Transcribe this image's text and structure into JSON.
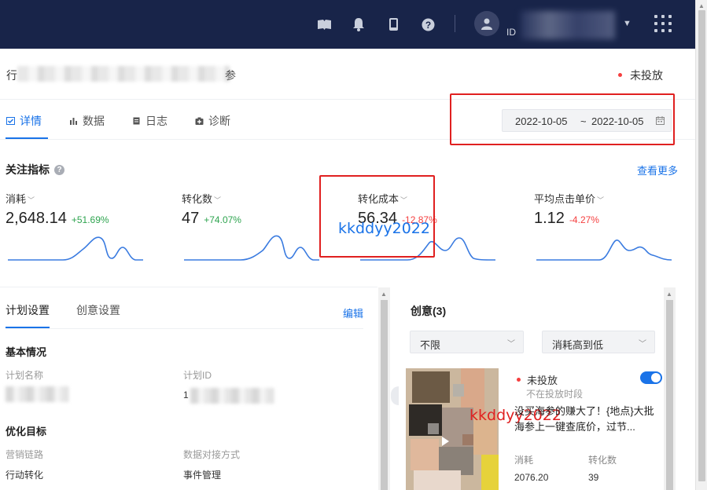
{
  "header": {
    "user_id_prefix": "ID",
    "icons": [
      "book-icon",
      "bell-icon",
      "phone-icon",
      "help-icon",
      "user-icon",
      "caret-down-icon",
      "app-grid-icon"
    ]
  },
  "plan": {
    "name_prefix": "行",
    "name_suffix": "参",
    "status": "未投放"
  },
  "tabs": [
    {
      "label": "详情",
      "active": true
    },
    {
      "label": "数据",
      "active": false
    },
    {
      "label": "日志",
      "active": false
    },
    {
      "label": "诊断",
      "active": false
    }
  ],
  "date_range": {
    "start": "2022-10-05",
    "separator": "~",
    "end": "2022-10-05"
  },
  "metrics_section": {
    "title": "关注指标",
    "see_more": "查看更多"
  },
  "metrics": [
    {
      "label": "消耗",
      "value": "2,648.14",
      "change": "+51.69%",
      "direction": "up"
    },
    {
      "label": "转化数",
      "value": "47",
      "change": "+74.07%",
      "direction": "up"
    },
    {
      "label": "转化成本",
      "value": "56.34",
      "change": "-12.87%",
      "direction": "down"
    },
    {
      "label": "平均点击单价",
      "value": "1.12",
      "change": "-4.27%",
      "direction": "down"
    }
  ],
  "watermark": "kkddyy2022",
  "left_panel": {
    "tabs": [
      "计划设置",
      "创意设置"
    ],
    "edit": "编辑",
    "basic_title": "基本情况",
    "plan_name_label": "计划名称",
    "plan_id_label": "计划ID",
    "plan_id_prefix": "1",
    "opt_title": "优化目标",
    "funnel_label": "营销链路",
    "funnel_value": "行动转化",
    "data_method_label": "数据对接方式",
    "data_method_value": "事件管理"
  },
  "creative_panel": {
    "title": "创意(3)",
    "filter_1": "不限",
    "filter_2": "消耗高到低",
    "status": "未投放",
    "sub_status": "不在投放时段",
    "description": "没买海参的赚大了！{地点}大批海参上一键查底价，过节...",
    "kpi_1_label": "消耗",
    "kpi_1_value": "2076.20",
    "kpi_2_label": "转化数",
    "kpi_2_value": "39"
  },
  "colors": {
    "topbar": "#182449",
    "accent": "#1a73e8",
    "up": "#2ea44f",
    "down": "#f53f3f",
    "annotation": "#e02020"
  }
}
